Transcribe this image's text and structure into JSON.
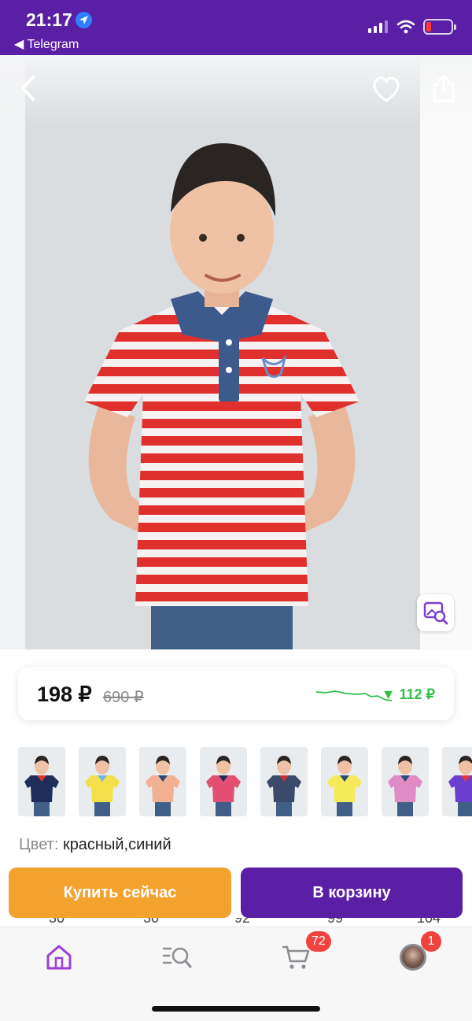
{
  "status_bar": {
    "time": "21:17",
    "back_app": "◀ Telegram"
  },
  "product": {
    "price_current": "198 ₽",
    "price_old": "690 ₽",
    "price_drop": "▼ 112 ₽",
    "color_label": "Цвет:",
    "color_value": "красный,синий"
  },
  "thumbnails": [
    {
      "shirt": "#1f2d5a",
      "accent": "#d33"
    },
    {
      "shirt": "#f4e04a",
      "accent": "#6ab6e8"
    },
    {
      "shirt": "#f2b093",
      "accent": "#2b4a7a"
    },
    {
      "shirt": "#e34f72",
      "accent": "#1f2d5a"
    },
    {
      "shirt": "#3a4a6a",
      "accent": "#c33"
    },
    {
      "shirt": "#f4ea5a",
      "accent": "#2b4a7a"
    },
    {
      "shirt": "#e08bc4",
      "accent": "#2b4a7a"
    },
    {
      "shirt": "#6a3fd0",
      "accent": "#e33"
    }
  ],
  "actions": {
    "buy_now": "Купить сейчас",
    "add_to_cart": "В корзину"
  },
  "peek_values": [
    "30",
    "30",
    "92",
    "99",
    "104"
  ],
  "bottom_nav": {
    "cart_badge": "72",
    "profile_badge": "1"
  },
  "colors": {
    "brand": "#5b1fa6",
    "buy": "#f3a22e",
    "drop": "#2fbf4a",
    "badge": "#f0433f"
  }
}
